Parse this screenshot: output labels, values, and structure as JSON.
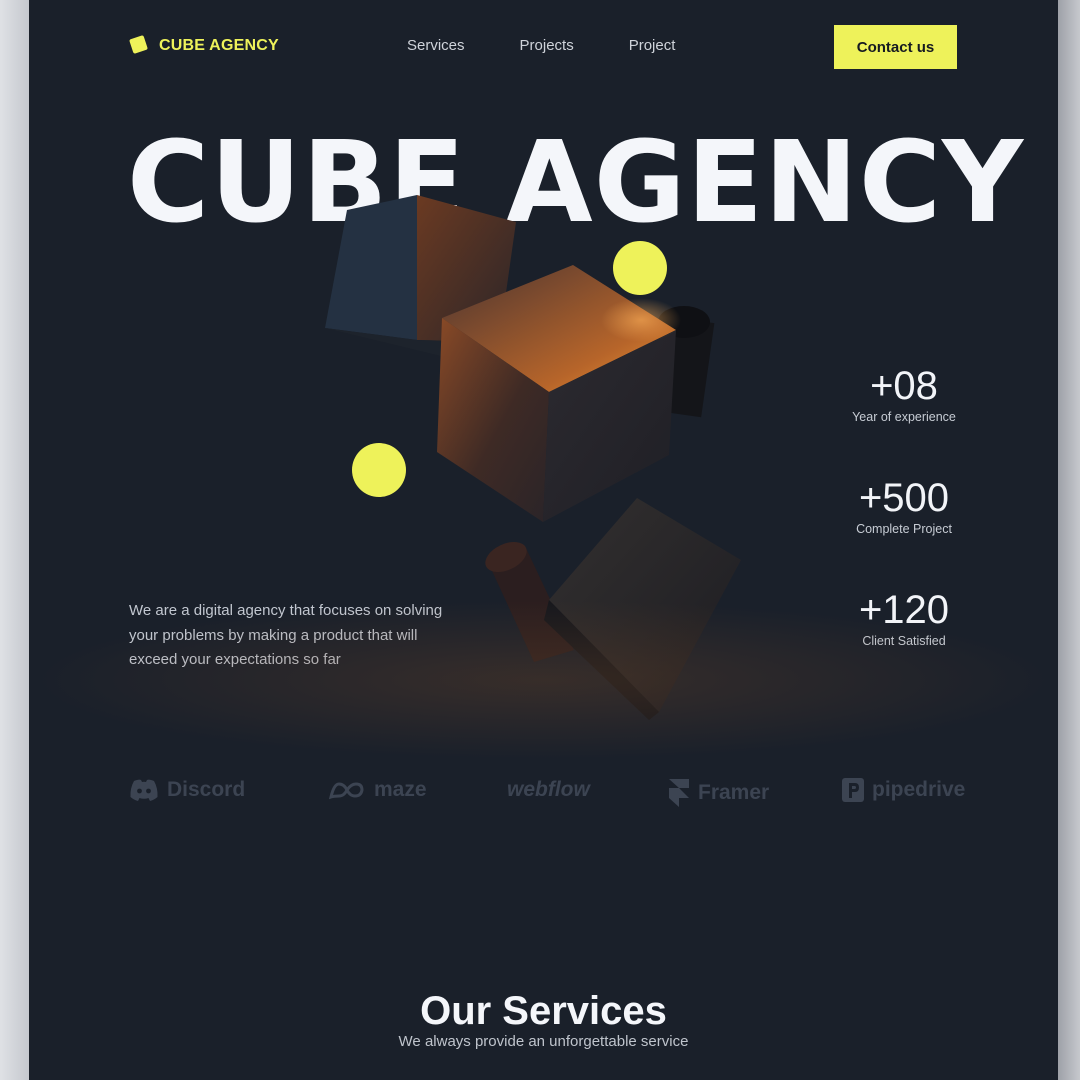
{
  "brand": {
    "name": "CUBE AGENCY",
    "accent": "#eef25a"
  },
  "nav": {
    "items": [
      "Services",
      "Projects",
      "Project"
    ]
  },
  "header": {
    "contact_label": "Contact us"
  },
  "hero": {
    "title": "CUBE AGENCY",
    "description": "We are a digital agency that focuses on solving your problems by making a product that will exceed your expectations so far"
  },
  "stats": [
    {
      "value": "+08",
      "label": "Year of experience"
    },
    {
      "value": "+500",
      "label": "Complete Project"
    },
    {
      "value": "+120",
      "label": "Client Satisfied"
    }
  ],
  "partners": [
    {
      "name": "Discord",
      "icon": "discord-icon"
    },
    {
      "name": "maze",
      "icon": "maze-icon"
    },
    {
      "name": "webflow",
      "icon": "none"
    },
    {
      "name": "Framer",
      "icon": "framer-icon"
    },
    {
      "name": "pipedrive",
      "icon": "pipedrive-icon"
    }
  ],
  "services": {
    "title": "Our Services",
    "subtitle": "We always provide an unforgettable service"
  },
  "colors": {
    "background": "#1a202a",
    "accent": "#eef25a",
    "cube": "#5a3a2a"
  }
}
